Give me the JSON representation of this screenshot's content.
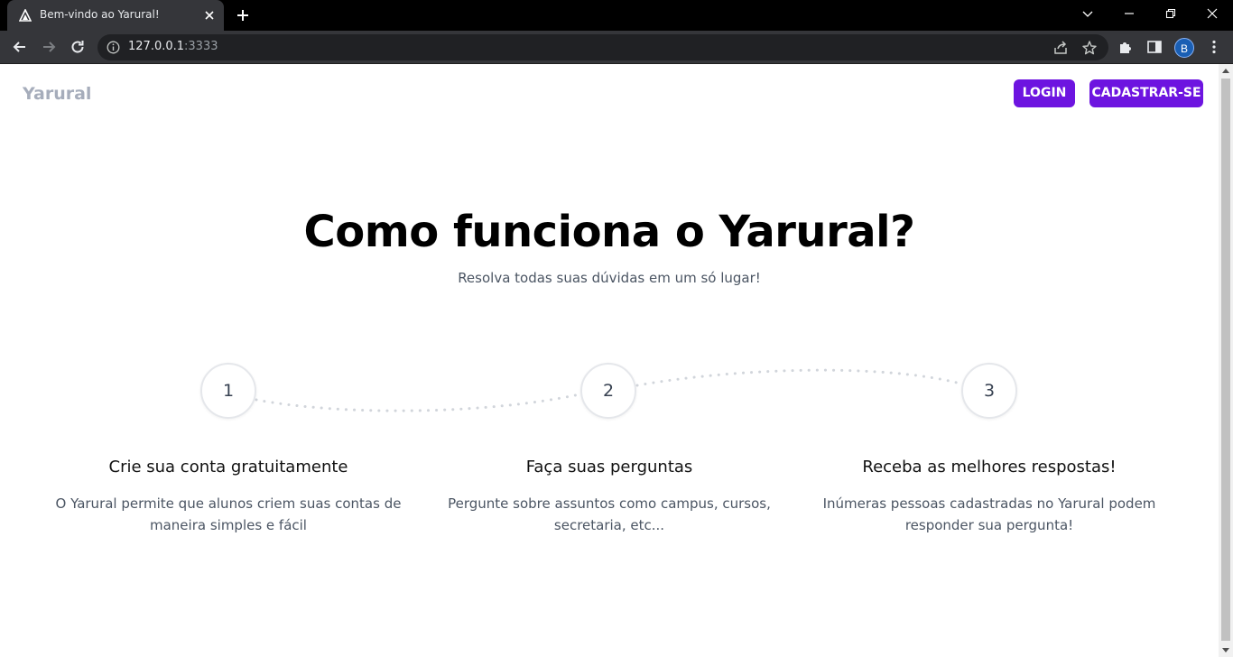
{
  "browser": {
    "tab_title": "Bem-vindo ao Yarural!",
    "url_host": "127.0.0.1",
    "url_port": ":3333",
    "profile_initial": "B"
  },
  "header": {
    "brand": "Yarural",
    "login_label": "LOGIN",
    "signup_label": "CADASTRAR-SE",
    "accent_color": "#6d14e0"
  },
  "hero": {
    "title": "Como funciona o Yarural?",
    "subtitle": "Resolva todas suas dúvidas em um só lugar!"
  },
  "steps": [
    {
      "number": "1",
      "title": "Crie sua conta gratuitamente",
      "line1": "O Yarural permite que alunos criem suas contas de",
      "line2": "maneira simples e fácil"
    },
    {
      "number": "2",
      "title": "Faça suas perguntas",
      "line1": "Pergunte sobre assuntos como campus, cursos,",
      "line2": "secretaria, etc..."
    },
    {
      "number": "3",
      "title": "Receba as melhores respostas!",
      "line1": "Inúmeras pessoas cadastradas no Yarural podem",
      "line2": "responder sua pergunta!"
    }
  ]
}
